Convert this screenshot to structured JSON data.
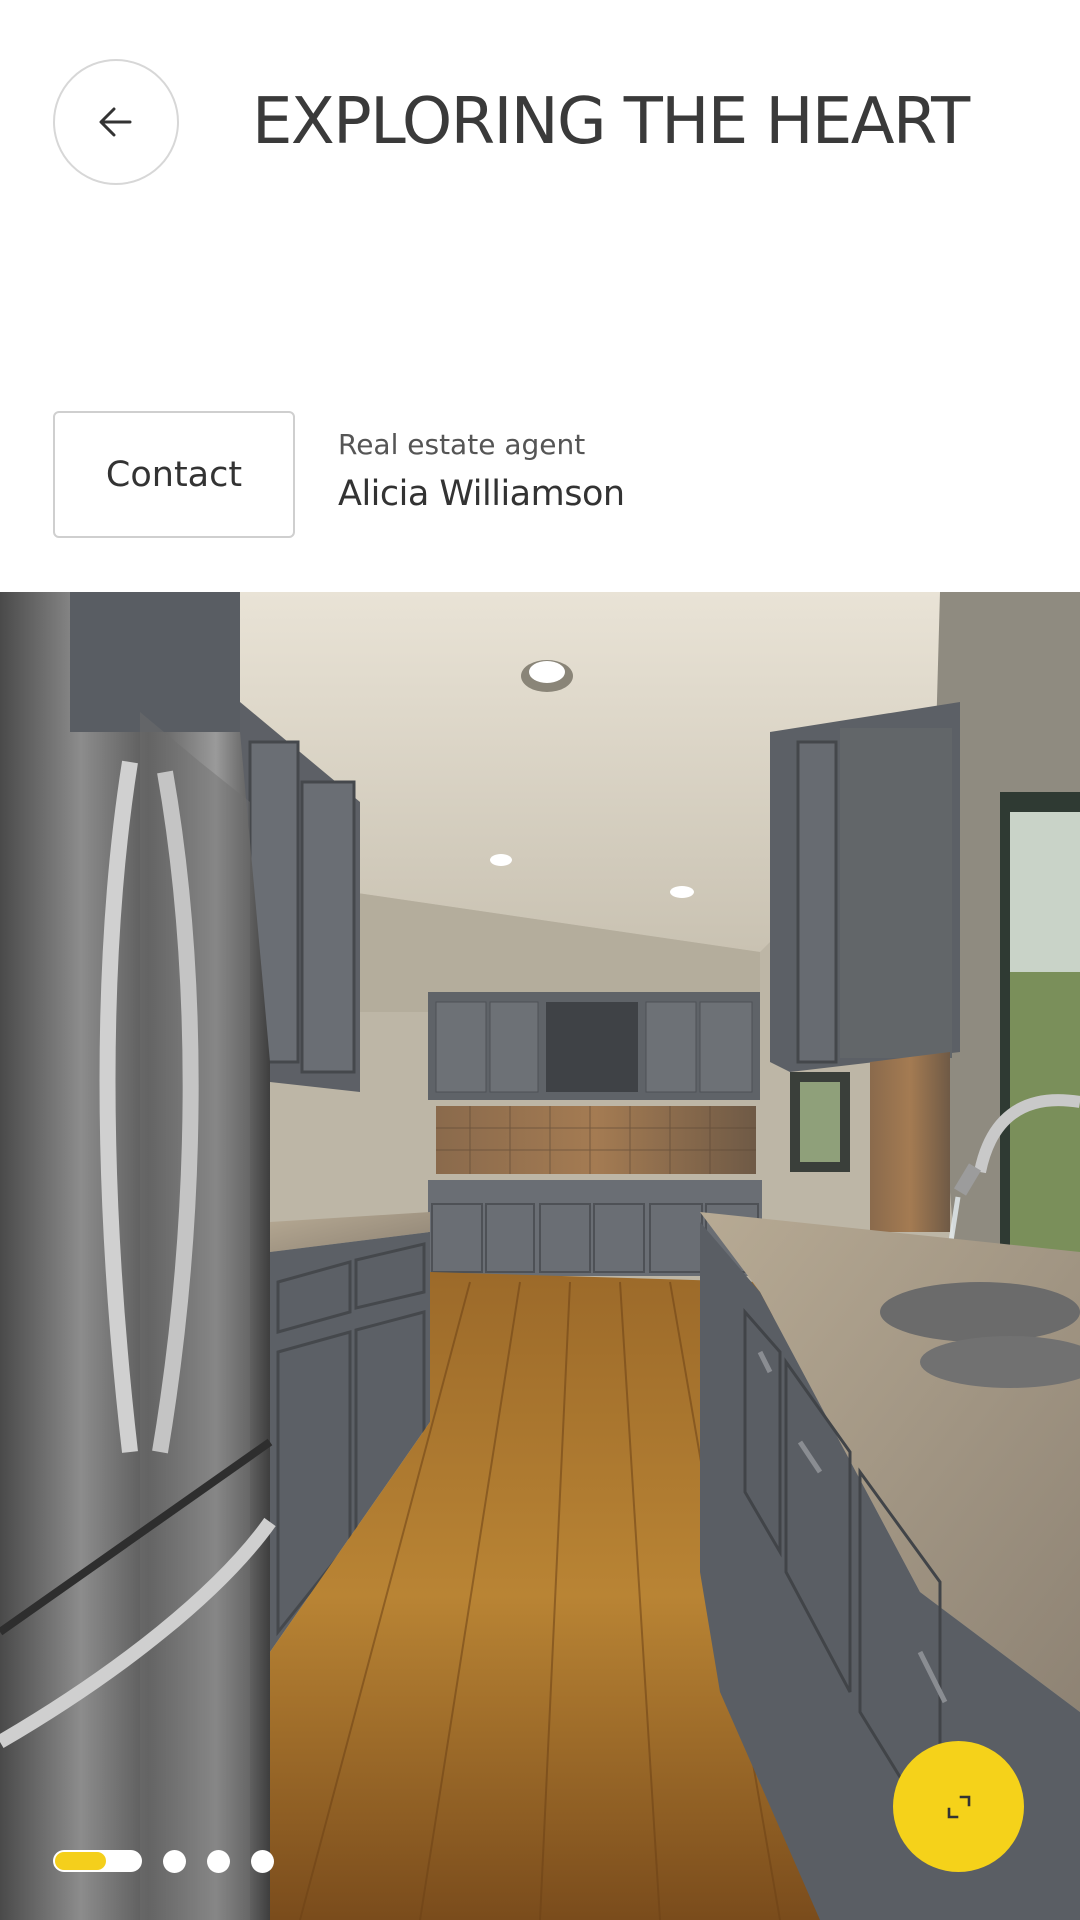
{
  "header": {
    "back_icon": "arrow-left-icon",
    "title": "EXPLORING THE HEART"
  },
  "agent": {
    "contact_label": "Contact",
    "role": "Real estate agent",
    "name": "Alicia Williamson"
  },
  "gallery": {
    "image_subject": "kitchen",
    "slide_count": 4,
    "active_slide": 1,
    "active_progress": 0.6,
    "expand_icon": "expand-icon"
  },
  "colors": {
    "accent": "#f5d21a",
    "indicator": "#f4cf1c",
    "title_text": "#3a3a3a",
    "border": "#d7d7d7"
  }
}
